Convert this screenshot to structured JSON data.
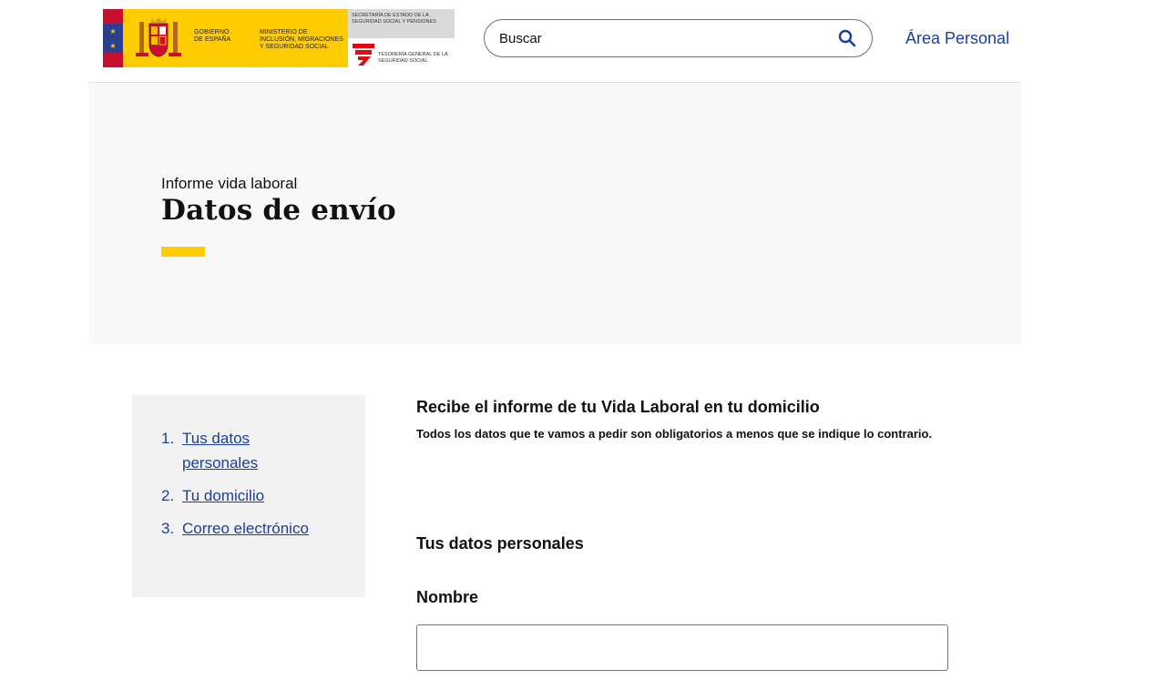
{
  "header": {
    "logo": {
      "gobierno": "GOBIERNO DE ESPAÑA",
      "ministerio": "MINISTERIO DE INCLUSIÓN, MIGRACIONES Y SEGURIDAD SOCIAL",
      "secretaria": "SECRETARÍA DE ESTADO DE LA SEGURIDAD SOCIAL Y PENSIONES",
      "tesoreria": "TESORERÍA GENERAL DE LA SEGURIDAD SOCIAL"
    },
    "search": {
      "placeholder": "Buscar",
      "icon": "search-icon"
    },
    "area_personal": "Área Personal"
  },
  "hero": {
    "subtitle": "Informe vida laboral",
    "title": "Datos de envío"
  },
  "sidenav": {
    "items": [
      {
        "num": "1.",
        "label": "Tus datos personales"
      },
      {
        "num": "2.",
        "label": "Tu domicilio"
      },
      {
        "num": "3.",
        "label": "Correo electrónico"
      }
    ]
  },
  "main": {
    "title": "Recibe el informe de tu Vida Laboral en tu domicilio",
    "note": "Todos los datos que te vamos a pedir son obligatorios a menos que se indique lo contrario.",
    "section_title": "Tus datos personales",
    "fields": {
      "nombre": {
        "label": "Nombre",
        "value": ""
      }
    }
  },
  "colors": {
    "link": "#1a3fa0",
    "accent_yellow": "#ffcc00",
    "hero_bg": "#f8f8f8",
    "sidenav_bg": "#f2f2f2"
  }
}
